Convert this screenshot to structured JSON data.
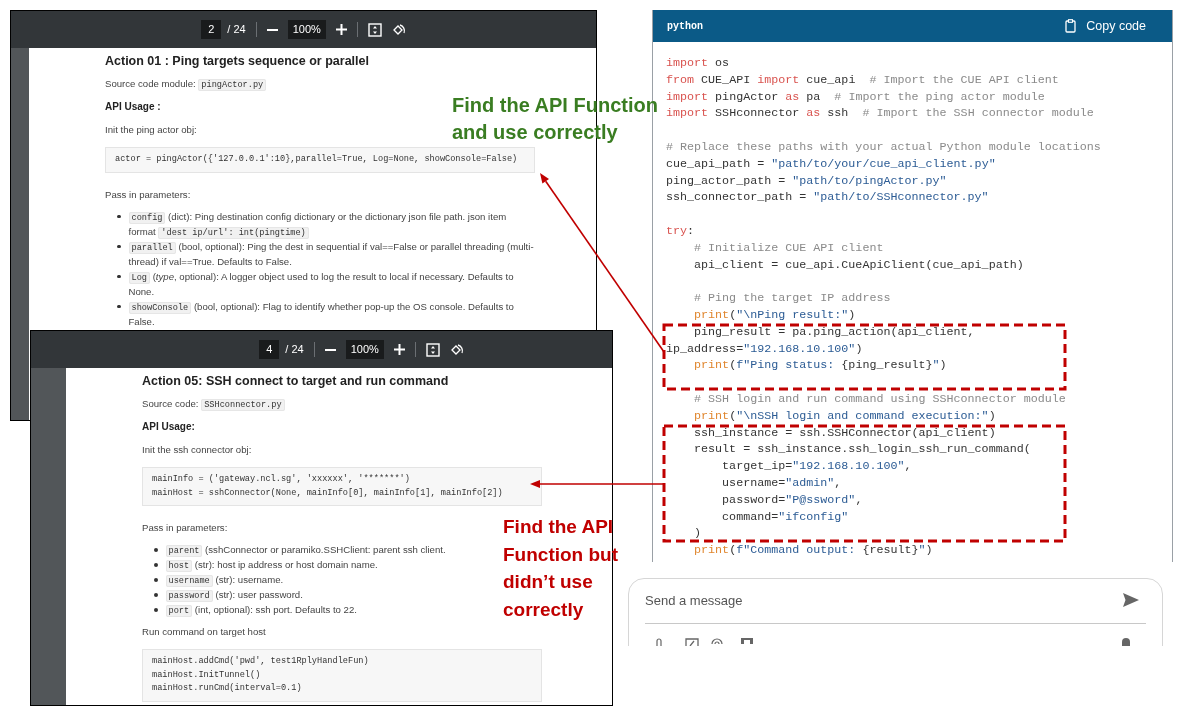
{
  "pdf_windows": [
    {
      "page": "2",
      "page_count": "/ 24",
      "zoom": "100%",
      "blocks": [
        {
          "kind": "heading",
          "text": "Action 01 : Ping targets sequence or parallel"
        },
        {
          "kind": "paragraph",
          "segments": [
            {
              "kind": "text",
              "text": "Source code module: "
            },
            {
              "kind": "code",
              "text": "pingActor.py"
            }
          ]
        },
        {
          "kind": "label",
          "text": "API Usage :"
        },
        {
          "kind": "paragraph",
          "segments": [
            {
              "kind": "text",
              "text": "Init the ping actor obj:"
            }
          ]
        },
        {
          "kind": "code_block",
          "lines": [
            "actor = pingActor({'127.0.0.1':10},parallel=True, Log=None, showConsole=False)"
          ]
        },
        {
          "kind": "paragraph",
          "segments": [
            {
              "kind": "text",
              "text": "Pass in parameters:"
            }
          ]
        },
        {
          "kind": "bullets",
          "items": [
            {
              "segments": [
                {
                  "kind": "code",
                  "text": "config"
                },
                {
                  "kind": "text",
                  "text": " (dict): Ping destination config dictionary or the dictionary json file path. json item format "
                },
                {
                  "kind": "code",
                  "text": "'dest ip/url': int(pingtime)"
                }
              ]
            },
            {
              "segments": [
                {
                  "kind": "code",
                  "text": "parallel"
                },
                {
                  "kind": "text",
                  "text": " (bool, optional): Ping the dest in sequential if val==False or parallel threading (multi-thread) if val==True. Defaults to False."
                }
              ]
            },
            {
              "segments": [
                {
                  "kind": "code",
                  "text": "Log"
                },
                {
                  "kind": "text",
                  "text": " (*type*, optional): A logger object used to log the result to local if necessary. Defaults to None."
                }
              ]
            },
            {
              "segments": [
                {
                  "kind": "code",
                  "text": "showConsole"
                },
                {
                  "kind": "text",
                  "text": " (bool, optional): Flag to identify whether pop-up the OS console. Defaults to False."
                }
              ]
            }
          ]
        }
      ]
    },
    {
      "page": "4",
      "page_count": "/ 24",
      "zoom": "100%",
      "blocks": [
        {
          "kind": "heading",
          "text": "Action 05: SSH connect to target and run command"
        },
        {
          "kind": "paragraph",
          "segments": [
            {
              "kind": "text",
              "text": "Source code: "
            },
            {
              "kind": "code",
              "text": "SSHconnector.py"
            }
          ]
        },
        {
          "kind": "label",
          "text": "API Usage:"
        },
        {
          "kind": "paragraph",
          "segments": [
            {
              "kind": "text",
              "text": "Init the ssh connector obj:"
            }
          ]
        },
        {
          "kind": "code_block",
          "lines": [
            "mainInfo = ('gateway.ncl.sg', 'xxxxxx', '*******')",
            "mainHost = sshConnector(None, mainInfo[0], mainInfo[1], mainInfo[2])"
          ]
        },
        {
          "kind": "paragraph",
          "segments": [
            {
              "kind": "text",
              "text": "Pass in parameters:"
            }
          ]
        },
        {
          "kind": "bullets",
          "items": [
            {
              "segments": [
                {
                  "kind": "code",
                  "text": "parent"
                },
                {
                  "kind": "text",
                  "text": " (sshConnector or paramiko.SSHClient: parent ssh client."
                }
              ]
            },
            {
              "segments": [
                {
                  "kind": "code",
                  "text": "host"
                },
                {
                  "kind": "text",
                  "text": " (str): host ip address or host domain name."
                }
              ]
            },
            {
              "segments": [
                {
                  "kind": "code",
                  "text": "username"
                },
                {
                  "kind": "text",
                  "text": " (str): username."
                }
              ]
            },
            {
              "segments": [
                {
                  "kind": "code",
                  "text": "password"
                },
                {
                  "kind": "text",
                  "text": " (str): user password."
                }
              ]
            },
            {
              "segments": [
                {
                  "kind": "code",
                  "text": "port"
                },
                {
                  "kind": "text",
                  "text": " (int, optional): ssh port. Defaults to 22."
                }
              ]
            }
          ]
        },
        {
          "kind": "paragraph",
          "segments": [
            {
              "kind": "text",
              "text": "Run command on target host"
            }
          ]
        },
        {
          "kind": "code_block",
          "lines": [
            "mainHost.addCmd('pwd', test1RplyHandleFun)",
            "mainHost.InitTunnel()",
            "mainHost.runCmd(interval=0.1)"
          ]
        }
      ]
    }
  ],
  "code_panel": {
    "language": "python",
    "copy_label": "Copy code",
    "lines": [
      {
        "kind": "code",
        "segments": [
          {
            "kind": "keyword",
            "text": "import"
          },
          {
            "kind": "plain",
            "text": " os"
          }
        ]
      },
      {
        "kind": "code",
        "segments": [
          {
            "kind": "keyword",
            "text": "from"
          },
          {
            "kind": "plain",
            "text": " CUE_API "
          },
          {
            "kind": "keyword",
            "text": "import"
          },
          {
            "kind": "plain",
            "text": " cue_api  "
          },
          {
            "kind": "comment",
            "text": "# Import the CUE API client"
          }
        ]
      },
      {
        "kind": "code",
        "segments": [
          {
            "kind": "keyword",
            "text": "import"
          },
          {
            "kind": "plain",
            "text": " pingActor "
          },
          {
            "kind": "keyword",
            "text": "as"
          },
          {
            "kind": "plain",
            "text": " pa  "
          },
          {
            "kind": "comment",
            "text": "# Import the ping actor module"
          }
        ]
      },
      {
        "kind": "code",
        "segments": [
          {
            "kind": "keyword",
            "text": "import"
          },
          {
            "kind": "plain",
            "text": " SSHconnector "
          },
          {
            "kind": "keyword",
            "text": "as"
          },
          {
            "kind": "plain",
            "text": " ssh  "
          },
          {
            "kind": "comment",
            "text": "# Import the SSH connector module"
          }
        ]
      },
      {
        "kind": "blank"
      },
      {
        "kind": "code",
        "segments": [
          {
            "kind": "comment",
            "text": "# Replace these paths with your actual Python module locations"
          }
        ]
      },
      {
        "kind": "code",
        "segments": [
          {
            "kind": "plain",
            "text": "cue_api_path = "
          },
          {
            "kind": "string",
            "text": "\"path/to/your/cue_api_client.py\""
          }
        ]
      },
      {
        "kind": "code",
        "segments": [
          {
            "kind": "plain",
            "text": "ping_actor_path = "
          },
          {
            "kind": "string",
            "text": "\"path/to/pingActor.py\""
          }
        ]
      },
      {
        "kind": "code",
        "segments": [
          {
            "kind": "plain",
            "text": "ssh_connector_path = "
          },
          {
            "kind": "string",
            "text": "\"path/to/SSHconnector.py\""
          }
        ]
      },
      {
        "kind": "blank"
      },
      {
        "kind": "code",
        "segments": [
          {
            "kind": "keyword",
            "text": "try"
          },
          {
            "kind": "plain",
            "text": ":"
          }
        ]
      },
      {
        "kind": "code",
        "segments": [
          {
            "kind": "comment",
            "text": "    # Initialize CUE API client"
          }
        ]
      },
      {
        "kind": "code",
        "segments": [
          {
            "kind": "plain",
            "text": "    api_client = cue_api.CueApiClient(cue_api_path)"
          }
        ]
      },
      {
        "kind": "blank"
      },
      {
        "kind": "code",
        "segments": [
          {
            "kind": "comment",
            "text": "    # Ping the target IP address"
          }
        ]
      },
      {
        "kind": "code",
        "segments": [
          {
            "kind": "builtin",
            "text": "    print"
          },
          {
            "kind": "plain",
            "text": "("
          },
          {
            "kind": "string",
            "text": "\"\\nPing result:\""
          },
          {
            "kind": "plain",
            "text": ")"
          }
        ]
      },
      {
        "kind": "code",
        "segments": [
          {
            "kind": "plain",
            "text": "    ping_result = pa.ping_action(api_client,"
          }
        ]
      },
      {
        "kind": "code",
        "segments": [
          {
            "kind": "plain",
            "text": "ip_address="
          },
          {
            "kind": "string",
            "text": "\"192.168.10.100\""
          },
          {
            "kind": "plain",
            "text": ")"
          }
        ]
      },
      {
        "kind": "code",
        "segments": [
          {
            "kind": "builtin",
            "text": "    print"
          },
          {
            "kind": "plain",
            "text": "("
          },
          {
            "kind": "string",
            "text": "f\"Ping status: "
          },
          {
            "kind": "plain",
            "text": "{ping_result}"
          },
          {
            "kind": "string",
            "text": "\""
          },
          {
            "kind": "plain",
            "text": ")"
          }
        ]
      },
      {
        "kind": "blank"
      },
      {
        "kind": "code",
        "segments": [
          {
            "kind": "comment",
            "text": "    # SSH login and run command using SSHconnector module"
          }
        ]
      },
      {
        "kind": "code",
        "segments": [
          {
            "kind": "builtin",
            "text": "    print"
          },
          {
            "kind": "plain",
            "text": "("
          },
          {
            "kind": "string",
            "text": "\"\\nSSH login and command execution:\""
          },
          {
            "kind": "plain",
            "text": ")"
          }
        ]
      },
      {
        "kind": "code",
        "segments": [
          {
            "kind": "plain",
            "text": "    ssh_instance = ssh.SSHConnector(api_client)"
          }
        ]
      },
      {
        "kind": "code",
        "segments": [
          {
            "kind": "plain",
            "text": "    result = ssh_instance.ssh_login_ssh_run_command("
          }
        ]
      },
      {
        "kind": "code",
        "segments": [
          {
            "kind": "plain",
            "text": "        target_ip="
          },
          {
            "kind": "string",
            "text": "\"192.168.10.100\""
          },
          {
            "kind": "plain",
            "text": ","
          }
        ]
      },
      {
        "kind": "code",
        "segments": [
          {
            "kind": "plain",
            "text": "        username="
          },
          {
            "kind": "string",
            "text": "\"admin\""
          },
          {
            "kind": "plain",
            "text": ","
          }
        ]
      },
      {
        "kind": "code",
        "segments": [
          {
            "kind": "plain",
            "text": "        password="
          },
          {
            "kind": "string",
            "text": "\"P@ssword\""
          },
          {
            "kind": "plain",
            "text": ","
          }
        ]
      },
      {
        "kind": "code",
        "segments": [
          {
            "kind": "plain",
            "text": "        command="
          },
          {
            "kind": "string",
            "text": "\"ifconfig\""
          }
        ]
      },
      {
        "kind": "code",
        "segments": [
          {
            "kind": "plain",
            "text": "    )"
          }
        ]
      },
      {
        "kind": "code",
        "segments": [
          {
            "kind": "builtin",
            "text": "    print"
          },
          {
            "kind": "plain",
            "text": "("
          },
          {
            "kind": "string",
            "text": "f\"Command output: "
          },
          {
            "kind": "plain",
            "text": "{result}"
          },
          {
            "kind": "string",
            "text": "\""
          },
          {
            "kind": "plain",
            "text": ")"
          }
        ]
      }
    ]
  },
  "chat_input": {
    "placeholder": "Send a message"
  },
  "annotations": [
    {
      "lines": [
        "Find the API Function",
        "and use correctly"
      ],
      "color": "#3a7d22"
    },
    {
      "lines": [
        "Find the API",
        "Function but",
        "didn’t use",
        "correctly"
      ],
      "color": "#c00000"
    }
  ]
}
